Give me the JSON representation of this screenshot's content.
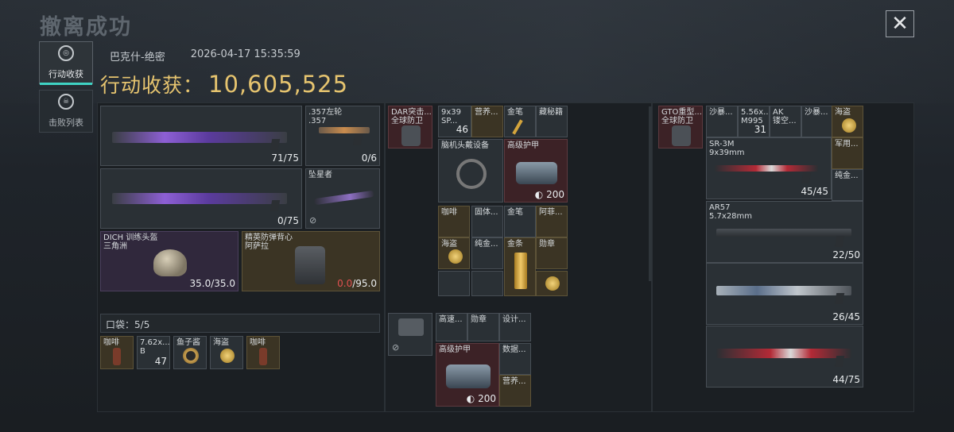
{
  "header": {
    "title": "撤离成功",
    "close_icon": "close-icon"
  },
  "sidebar": [
    {
      "label": "行动收获",
      "icon": "haul-icon",
      "active": true
    },
    {
      "label": "击败列表",
      "icon": "skull-icon",
      "active": false
    }
  ],
  "meta": {
    "map": "巴克什-绝密",
    "datetime": "2026-04-17 15:35:59"
  },
  "haul": {
    "label": "行动收获：",
    "value": "10,605,525"
  },
  "loadout": {
    "primary1": {
      "ammo": "71/75"
    },
    "primary2": {
      "ammo": "0/75"
    },
    "pistol": {
      "name": ".357左轮\n.357",
      "ammo": "0/6"
    },
    "melee": {
      "name": "坠星者"
    },
    "helmet": {
      "name": "DICH 训练头盔\n三角洲",
      "durability": "35.0/35.0"
    },
    "armor": {
      "name": "精英防弹背心\n阿萨拉",
      "dur_cur": "0.0",
      "dur_max": "/95.0"
    },
    "pocket": {
      "label": "口袋：",
      "capacity": "5/5",
      "items": [
        {
          "name": "咖啡"
        },
        {
          "name": "7.62x...\nB",
          "count": "47"
        },
        {
          "name": "鱼子酱"
        },
        {
          "name": "海盗"
        },
        {
          "name": "咖啡"
        }
      ]
    }
  },
  "rig": {
    "slot": {
      "name": "DAR突击...\n全球防卫"
    },
    "items": [
      {
        "name": "9x39\nSP...",
        "count": "46"
      },
      {
        "name": "营养..."
      },
      {
        "name": "金笔"
      },
      {
        "name": "藏秘籍"
      },
      {
        "name": "脑机头戴设备"
      },
      {
        "name": "高级护甲",
        "value": "200"
      },
      {
        "name": "咖啡"
      },
      {
        "name": "固体..."
      },
      {
        "name": "金笔"
      },
      {
        "name": "阿菲..."
      },
      {
        "name": "海盗"
      },
      {
        "name": "纯金..."
      },
      {
        "name": "金条"
      },
      {
        "name": "勋章"
      }
    ]
  },
  "backpack2": {
    "items": [
      {
        "name": "高速..."
      },
      {
        "name": "勋章"
      },
      {
        "name": "设计..."
      },
      {
        "name": "高级护甲",
        "value": "200"
      },
      {
        "name": "数据..."
      },
      {
        "name": "营养..."
      }
    ]
  },
  "bag": {
    "slot": {
      "name": "GTO重型...\n全球防卫"
    },
    "top": [
      {
        "name": "沙暴..."
      },
      {
        "name": "5.56x...\nM995",
        "count": "31"
      },
      {
        "name": "AK\n镂空..."
      },
      {
        "name": "沙暴..."
      },
      {
        "name": "海盗"
      }
    ],
    "guns": [
      {
        "name": "SR-3M\n9x39mm",
        "ammo": "45/45"
      },
      {
        "name": "AR57\n5.7x28mm",
        "ammo": "22/50"
      },
      {
        "name": "",
        "ammo": "26/45"
      },
      {
        "name": "",
        "ammo": "44/75"
      }
    ],
    "side": [
      {
        "name": "军用..."
      },
      {
        "name": "纯金..."
      }
    ]
  }
}
